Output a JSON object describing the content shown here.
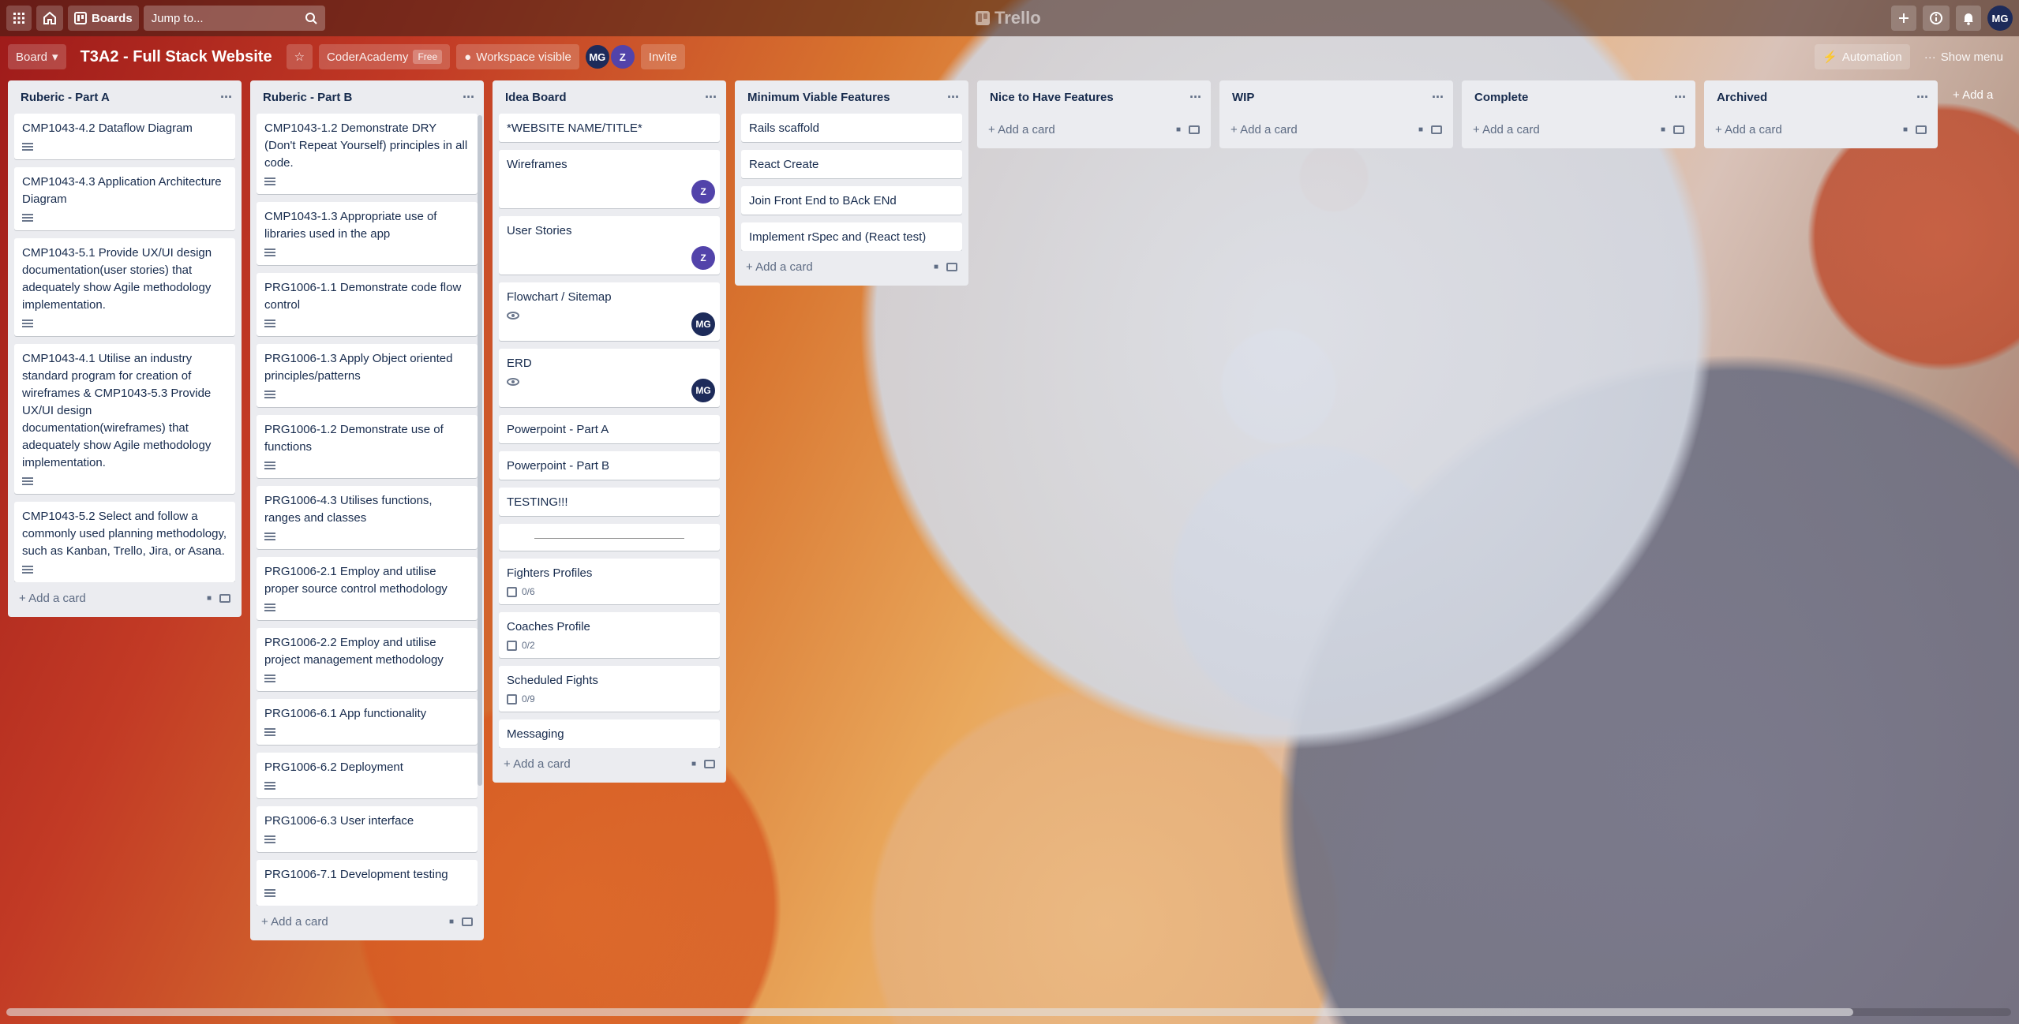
{
  "header": {
    "boards_label": "Boards",
    "search_placeholder": "Jump to...",
    "logo_text": "Trello",
    "user_initials": "MG"
  },
  "board": {
    "view_label": "Board",
    "title": "T3A2 - Full Stack Website",
    "workspace": "CoderAcademy",
    "workspace_plan": "Free",
    "visibility": "Workspace visible",
    "members": [
      {
        "initials": "MG",
        "color": "#1d2b5a"
      },
      {
        "initials": "Z",
        "color": "#5243aa"
      }
    ],
    "invite_label": "Invite",
    "automation_label": "Automation",
    "show_menu_label": "Show menu"
  },
  "add_card_label": "Add a card",
  "add_list_label": "Add another list",
  "lists": [
    {
      "title": "Ruberic - Part A",
      "cards": [
        {
          "text": "CMP1043-4.2 Dataflow Diagram",
          "desc": true
        },
        {
          "text": "CMP1043-4.3 Application Architecture Diagram",
          "desc": true
        },
        {
          "text": "CMP1043-5.1 Provide UX/UI design documentation(user stories) that adequately show Agile methodology implementation.",
          "desc": true
        },
        {
          "text": "CMP1043-4.1 Utilise an industry standard program for creation of wireframes & CMP1043-5.3 Provide UX/UI design documentation(wireframes) that adequately show Agile methodology implementation.",
          "desc": true
        },
        {
          "text": "CMP1043-5.2 Select and follow a commonly used planning methodology, such as Kanban, Trello, Jira, or Asana.",
          "desc": true
        }
      ]
    },
    {
      "title": "Ruberic - Part B",
      "cards": [
        {
          "text": "CMP1043-1.2 Demonstrate DRY (Don't Repeat Yourself) principles in all code.",
          "desc": true
        },
        {
          "text": "CMP1043-1.3 Appropriate use of libraries used in the app",
          "desc": true
        },
        {
          "text": "PRG1006-1.1 Demonstrate code flow control",
          "desc": true
        },
        {
          "text": "PRG1006-1.3 Apply Object oriented principles/patterns",
          "desc": true
        },
        {
          "text": "PRG1006-1.2 Demonstrate use of functions",
          "desc": true
        },
        {
          "text": "PRG1006-4.3 Utilises functions, ranges and classes",
          "desc": true
        },
        {
          "text": "PRG1006-2.1 Employ and utilise proper source control methodology",
          "desc": true
        },
        {
          "text": "PRG1006-2.2 Employ and utilise project management methodology",
          "desc": true
        },
        {
          "text": "PRG1006-6.1 App functionality",
          "desc": true
        },
        {
          "text": "PRG1006-6.2 Deployment",
          "desc": true
        },
        {
          "text": "PRG1006-6.3 User interface",
          "desc": true
        },
        {
          "text": "PRG1006-7.1 Development testing",
          "desc": true
        }
      ]
    },
    {
      "title": "Idea Board",
      "cards": [
        {
          "text": "*WEBSITE NAME/TITLE*"
        },
        {
          "text": "Wireframes",
          "member": "Z",
          "member_color": "#5243aa"
        },
        {
          "text": "User Stories",
          "member": "Z",
          "member_color": "#5243aa"
        },
        {
          "text": "Flowchart / Sitemap",
          "watch": true,
          "member": "MG",
          "member_color": "#1d2b5a"
        },
        {
          "text": "ERD",
          "watch": true,
          "member": "MG",
          "member_color": "#1d2b5a"
        },
        {
          "text": "Powerpoint - Part A"
        },
        {
          "text": "Powerpoint - Part B"
        },
        {
          "text": "TESTING!!!"
        },
        {
          "separator": true
        },
        {
          "text": "Fighters Profiles",
          "checklist": "0/6"
        },
        {
          "text": "Coaches Profile",
          "checklist": "0/2"
        },
        {
          "text": "Scheduled Fights",
          "checklist": "0/9"
        },
        {
          "text": "Messaging"
        }
      ]
    },
    {
      "title": "Minimum Viable Features",
      "cards": [
        {
          "text": "Rails scaffold"
        },
        {
          "text": "React Create"
        },
        {
          "text": "Join Front End to BAck ENd"
        },
        {
          "text": "Implement rSpec and (React test)"
        }
      ]
    },
    {
      "title": "Nice to Have Features",
      "cards": []
    },
    {
      "title": "WIP",
      "cards": []
    },
    {
      "title": "Complete",
      "cards": []
    },
    {
      "title": "Archived",
      "cards": []
    }
  ]
}
